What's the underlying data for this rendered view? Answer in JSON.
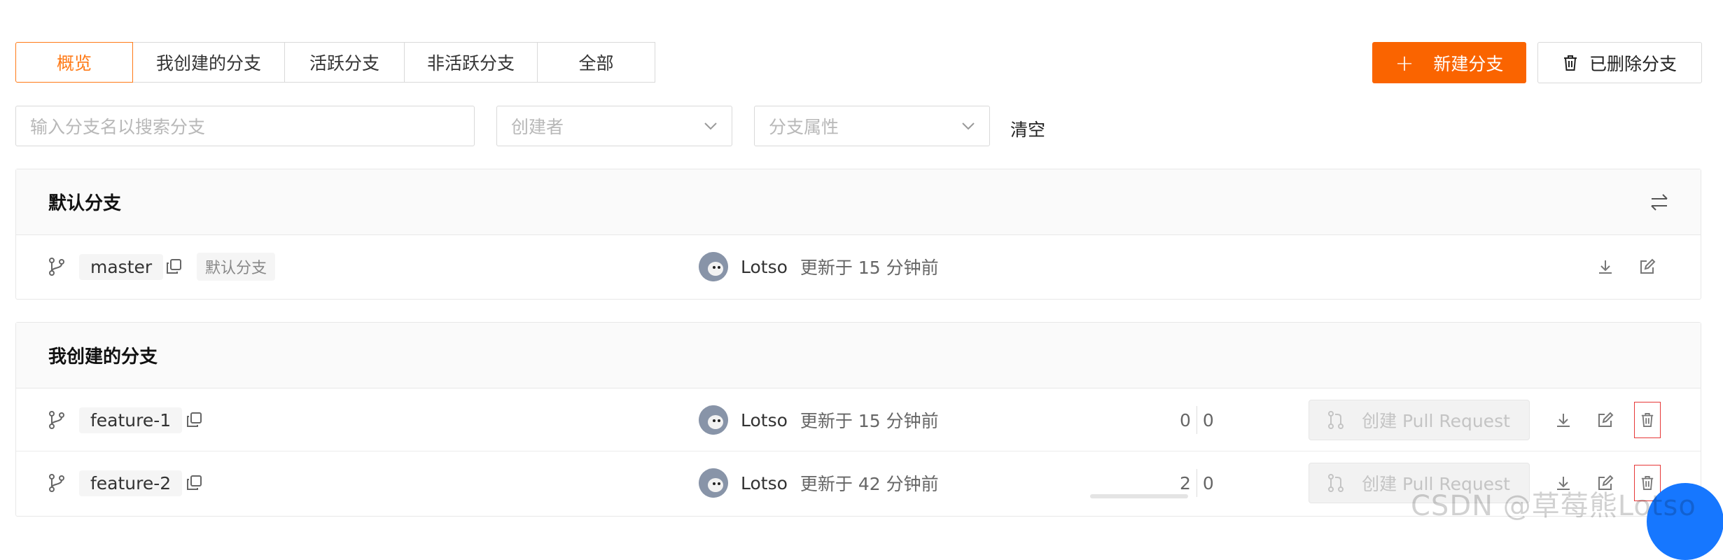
{
  "tabs": [
    {
      "label": "概览",
      "active": true
    },
    {
      "label": "我创建的分支",
      "active": false
    },
    {
      "label": "活跃分支",
      "active": false
    },
    {
      "label": "非活跃分支",
      "active": false
    },
    {
      "label": "全部",
      "active": false
    }
  ],
  "actions": {
    "new_branch": "新建分支",
    "deleted_branches": "已删除分支"
  },
  "filters": {
    "search_placeholder": "输入分支名以搜索分支",
    "creator_placeholder": "创建者",
    "attribute_placeholder": "分支属性",
    "clear_label": "清空"
  },
  "default_section": {
    "title": "默认分支",
    "rows": [
      {
        "branch": "master",
        "tag": "默认分支",
        "author": "Lotso",
        "updated": "更新于 15 分钟前"
      }
    ]
  },
  "my_section": {
    "title": "我创建的分支",
    "rows": [
      {
        "branch": "feature-1",
        "author": "Lotso",
        "updated": "更新于 15 分钟前",
        "behind": "0",
        "ahead": "0",
        "pr_label": "创建 Pull Request"
      },
      {
        "branch": "feature-2",
        "author": "Lotso",
        "updated": "更新于 42 分钟前",
        "behind": "2",
        "ahead": "0",
        "pr_label": "创建 Pull Request"
      }
    ]
  },
  "watermark": "CSDN @草莓熊Lotso",
  "colors": {
    "accent": "#ff7a17",
    "primary_button": "#fa6400",
    "danger_outline": "#e63838"
  },
  "icons": [
    "plus-icon",
    "trash-icon",
    "chevron-down-icon",
    "swap-icon",
    "branch-icon",
    "copy-icon",
    "download-icon",
    "edit-icon",
    "pull-request-icon"
  ]
}
